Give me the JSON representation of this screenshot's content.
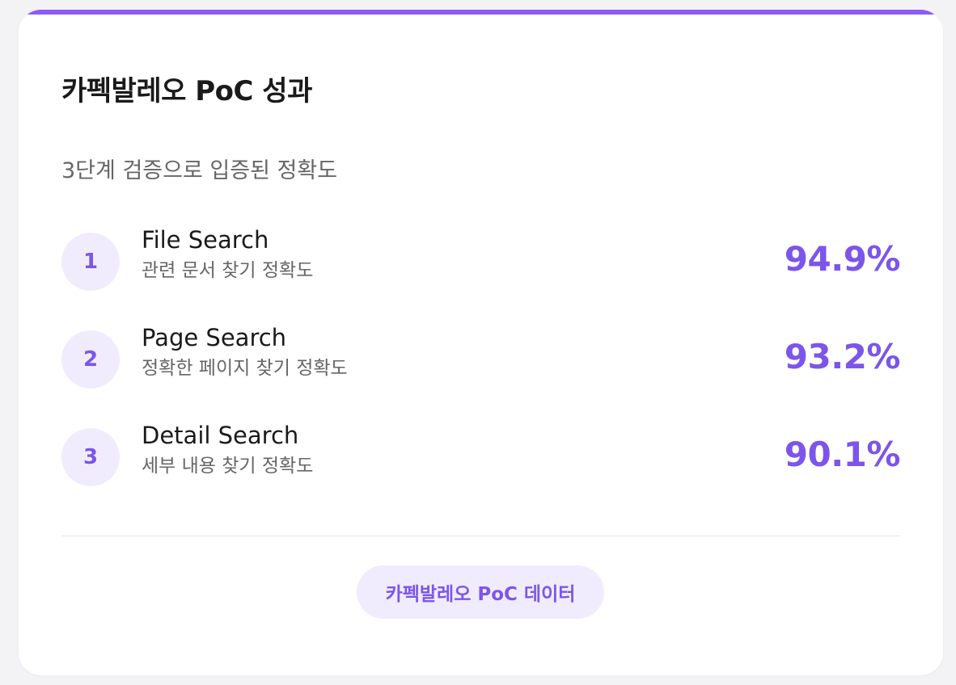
{
  "card": {
    "title": "카펙발레오 PoC 성과",
    "subtitle": "3단계 검증으로 입증된 정확도",
    "accent_color": "#8b5cf6",
    "steps": [
      {
        "number": "1",
        "name": "File Search",
        "description": "관련 문서 찾기 정확도",
        "value": "94.9%"
      },
      {
        "number": "2",
        "name": "Page Search",
        "description": "정확한 페이지 찾기 정확도",
        "value": "93.2%"
      },
      {
        "number": "3",
        "name": "Detail Search",
        "description": "세부 내용 찾기 정확도",
        "value": "90.1%"
      }
    ],
    "footer_button_label": "카펙발레오 PoC 데이터"
  }
}
